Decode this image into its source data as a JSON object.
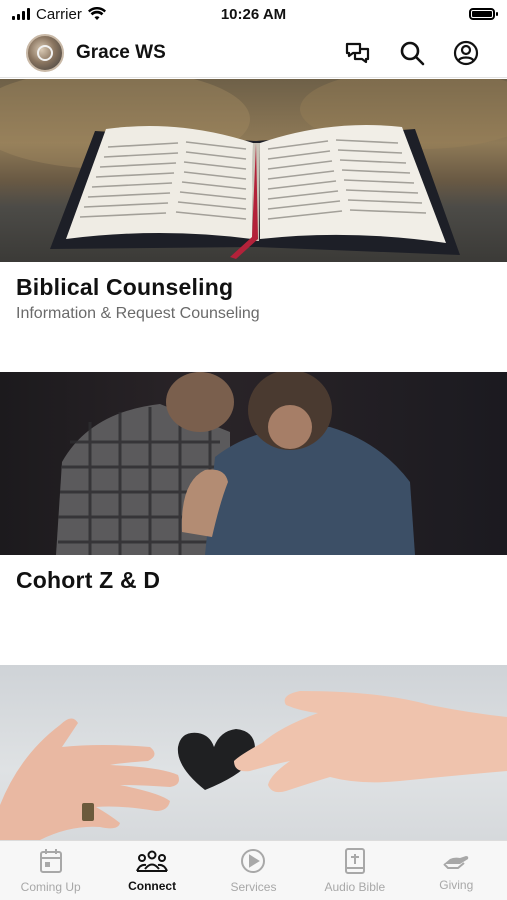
{
  "status_bar": {
    "carrier": "Carrier",
    "time": "10:26 AM"
  },
  "header": {
    "title": "Grace WS",
    "icons": [
      "chat-icon",
      "search-icon",
      "account-icon"
    ]
  },
  "cards": [
    {
      "title": "Biblical Counseling",
      "subtitle": "Information & Request Counseling",
      "image": "open-bible-photo"
    },
    {
      "title": "Cohort Z & D",
      "subtitle": "",
      "image": "two-men-praying-photo"
    },
    {
      "title": "",
      "subtitle": "",
      "image": "hands-passing-heart-photo"
    }
  ],
  "tabs": [
    {
      "label": "Coming Up",
      "icon": "calendar-icon",
      "active": false
    },
    {
      "label": "Connect",
      "icon": "group-icon",
      "active": true
    },
    {
      "label": "Services",
      "icon": "play-icon",
      "active": false
    },
    {
      "label": "Audio Bible",
      "icon": "bible-icon",
      "active": false
    },
    {
      "label": "Giving",
      "icon": "giving-hand-icon",
      "active": false
    }
  ],
  "colors": {
    "active_tab": "#111111",
    "inactive_tab": "#a8a8a8",
    "subtitle": "#6a6a6a"
  }
}
